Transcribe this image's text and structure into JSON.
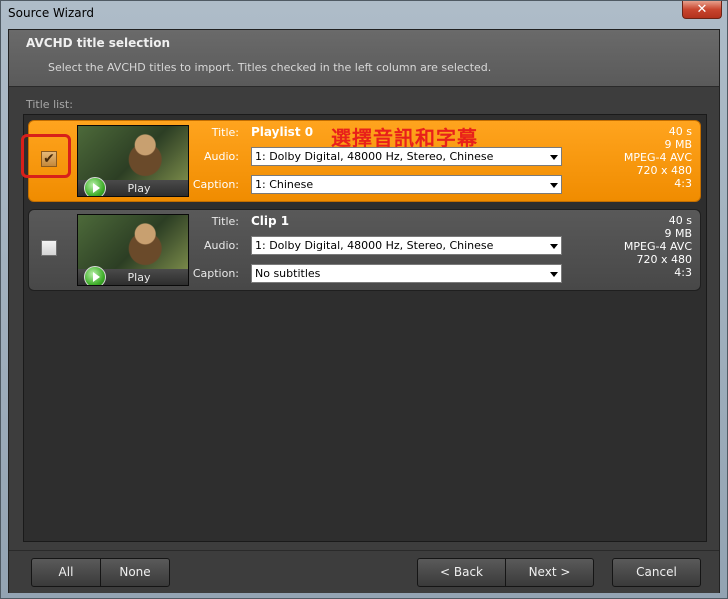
{
  "window": {
    "title": "Source Wizard",
    "close_glyph": "✕"
  },
  "header": {
    "title": "AVCHD title selection",
    "subtitle": "Select the AVCHD titles to import. Titles checked in the left column are selected."
  },
  "list_label": "Title list:",
  "labels": {
    "title": "Title:",
    "audio": "Audio:",
    "caption": "Caption:",
    "play": "Play"
  },
  "titles": [
    {
      "checked": true,
      "title": "Playlist 0",
      "audio": "1: Dolby Digital,  48000 Hz,  Stereo,  Chinese",
      "caption": "1: Chinese",
      "duration": "40 s",
      "size": "9 MB",
      "codec": "MPEG-4 AVC",
      "resolution": "720 x 480",
      "aspect": "4:3"
    },
    {
      "checked": false,
      "title": "Clip 1",
      "audio": "1: Dolby Digital,  48000 Hz,  Stereo,  Chinese",
      "caption": "No subtitles",
      "duration": "40 s",
      "size": "9 MB",
      "codec": "MPEG-4 AVC",
      "resolution": "720 x 480",
      "aspect": "4:3"
    }
  ],
  "annotation": "選擇音訊和字幕",
  "buttons": {
    "all": "All",
    "none": "None",
    "back": "< Back",
    "next": "Next >",
    "cancel": "Cancel"
  },
  "colors": {
    "selected_row": "#f29000",
    "annotation": "#e8201a"
  }
}
